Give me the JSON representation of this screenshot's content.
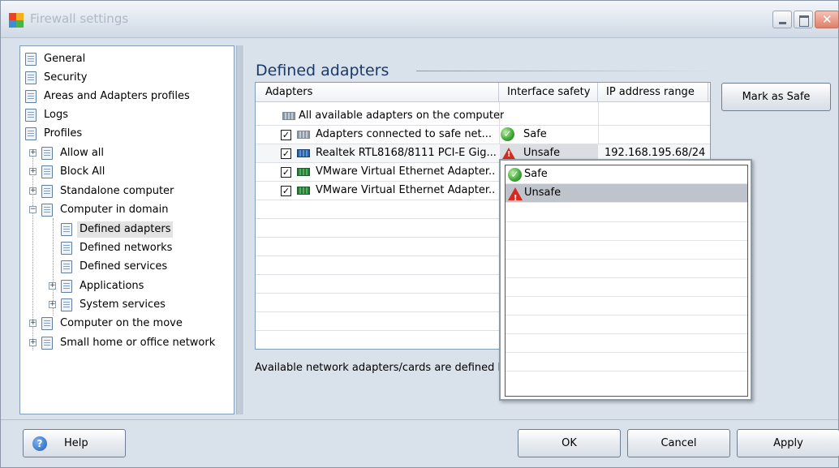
{
  "window": {
    "title": "Firewall settings"
  },
  "tree": {
    "items": [
      {
        "label": "General"
      },
      {
        "label": "Security"
      },
      {
        "label": "Areas and Adapters profiles"
      },
      {
        "label": "Logs"
      },
      {
        "label": "Profiles"
      },
      {
        "label": "Allow all"
      },
      {
        "label": "Block All"
      },
      {
        "label": "Standalone computer"
      },
      {
        "label": "Computer in domain"
      },
      {
        "label": "Defined adapters"
      },
      {
        "label": "Defined networks"
      },
      {
        "label": "Defined services"
      },
      {
        "label": "Applications"
      },
      {
        "label": "System services"
      },
      {
        "label": "Computer on the move"
      },
      {
        "label": "Small home or office network"
      }
    ],
    "selected": "Defined adapters"
  },
  "main": {
    "title": "Defined adapters",
    "columns": [
      "Adapters",
      "Interface safety",
      "IP address range"
    ],
    "rows": [
      {
        "adapter": "All available adapters on the computer",
        "safety": "",
        "ip": "",
        "checked": false
      },
      {
        "adapter": "Adapters connected to safe net...",
        "safety": "Safe",
        "ip": "",
        "checked": true
      },
      {
        "adapter": "Realtek RTL8168/8111 PCI-E Gig...",
        "safety": "Unsafe",
        "ip": "192.168.195.68/24",
        "checked": true
      },
      {
        "adapter": "VMware Virtual Ethernet Adapter...",
        "safety": "",
        "ip": "",
        "checked": true
      },
      {
        "adapter": "VMware Virtual Ethernet Adapter...",
        "safety": "",
        "ip": "",
        "checked": true
      }
    ],
    "description": "Available network adapters/cards are defined he",
    "dropdown_options": [
      "Safe",
      "Unsafe"
    ],
    "dropdown_highlighted": "Unsafe"
  },
  "buttons": {
    "mark_safe": "Mark as Safe",
    "help": "Help",
    "ok": "OK",
    "cancel": "Cancel",
    "apply": "Apply"
  },
  "colors": {
    "title_text": "#1a3a6a",
    "selection": "#bfc4cc",
    "unsafe": "#d62a1e",
    "safe": "#3aa332"
  }
}
